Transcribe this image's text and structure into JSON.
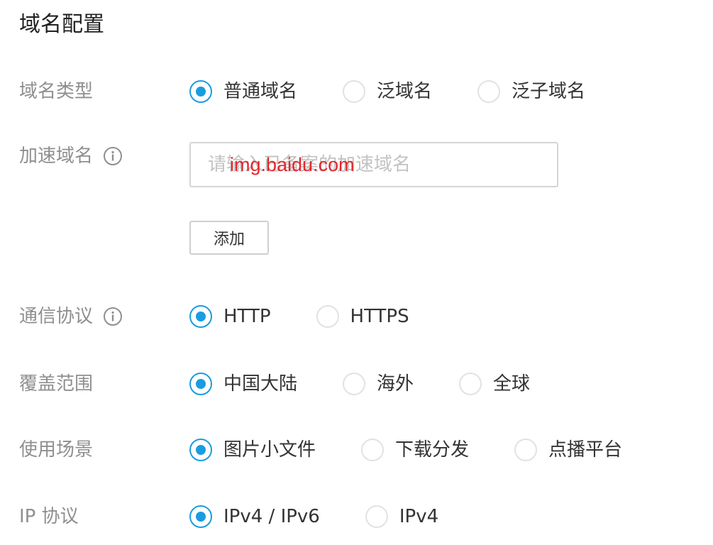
{
  "page_title": "域名配置",
  "domain_type": {
    "label": "域名类型",
    "options": [
      "普通域名",
      "泛域名",
      "泛子域名"
    ],
    "selected_index": 0
  },
  "accel_domain": {
    "label": "加速域名",
    "info_icon": "info-icon",
    "placeholder": "请输入已备案的加速域名",
    "watermark": "img.baidu.com",
    "add_label": "添加"
  },
  "protocol": {
    "label": "通信协议",
    "info_icon": "info-icon",
    "options": [
      "HTTP",
      "HTTPS"
    ],
    "selected_index": 0
  },
  "coverage": {
    "label": "覆盖范围",
    "options": [
      "中国大陆",
      "海外",
      "全球"
    ],
    "selected_index": 0
  },
  "scenario": {
    "label": "使用场景",
    "options": [
      "图片小文件",
      "下载分发",
      "点播平台"
    ],
    "selected_index": 0
  },
  "ip_protocol": {
    "label": "IP 协议",
    "options": [
      "IPv4 / IPv6",
      "IPv4"
    ],
    "selected_index": 0
  },
  "colors": {
    "accent": "#1a9ce0",
    "label_gray": "#8f8f8f",
    "watermark_red": "#e4262b"
  }
}
